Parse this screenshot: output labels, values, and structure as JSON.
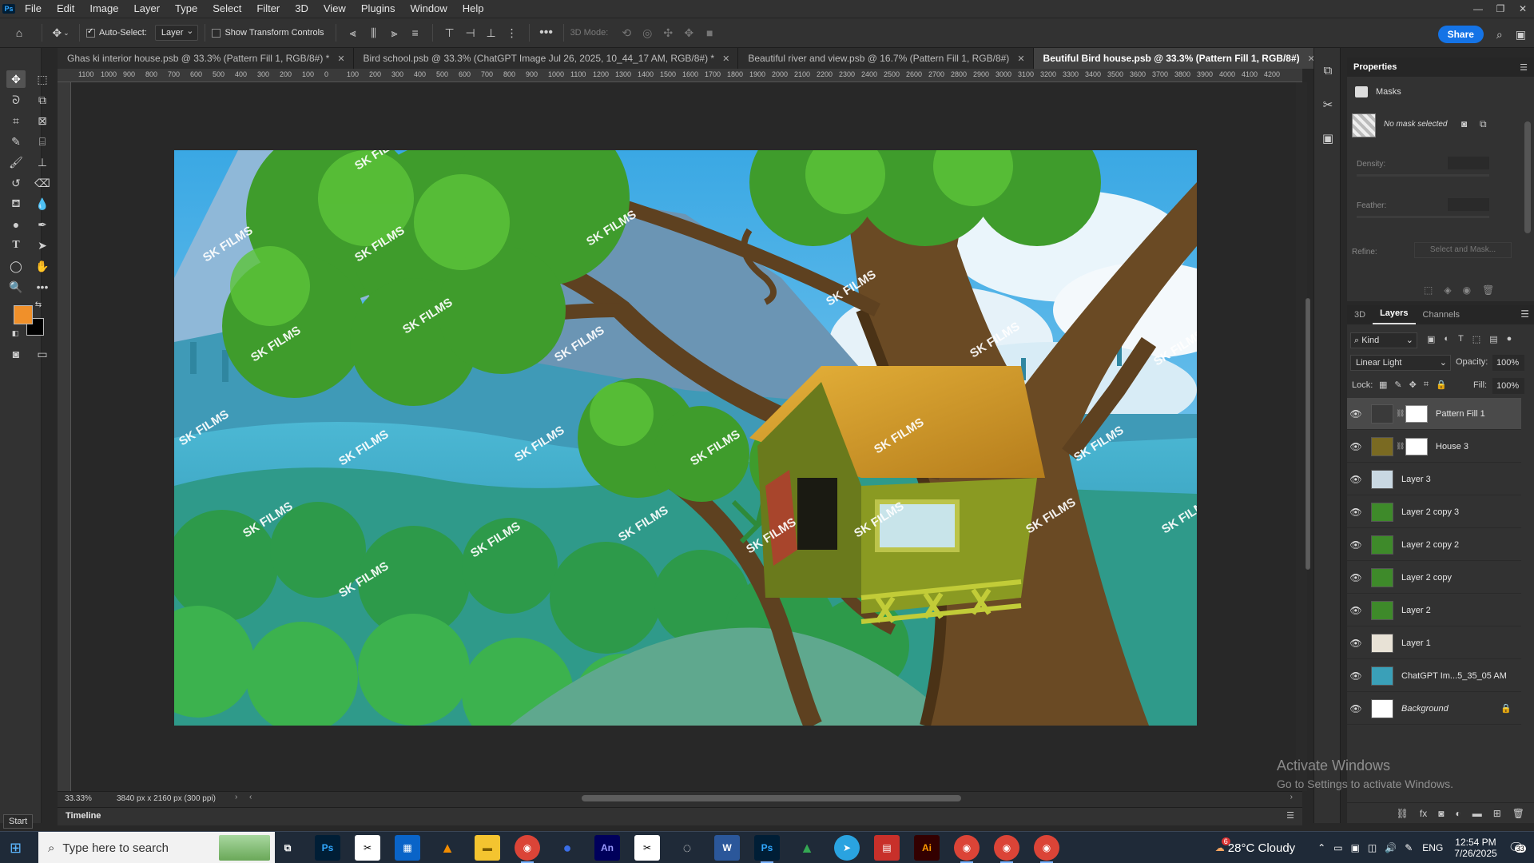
{
  "app": {
    "logo": "Ps"
  },
  "menu": [
    "File",
    "Edit",
    "Image",
    "Layer",
    "Type",
    "Select",
    "Filter",
    "3D",
    "View",
    "Plugins",
    "Window",
    "Help"
  ],
  "options_bar": {
    "auto_select_label": "Auto-Select:",
    "auto_select_checked": true,
    "auto_select_target": "Layer",
    "show_transform_label": "Show Transform Controls",
    "mode_3d_label": "3D Mode:",
    "share_label": "Share"
  },
  "tabs": [
    {
      "label": "Ghas ki interior house.psb @ 33.3% (Pattern Fill 1, RGB/8#) *",
      "active": false
    },
    {
      "label": "Bird school.psb @ 33.3% (ChatGPT Image Jul 26, 2025, 10_44_17 AM, RGB/8#) *",
      "active": false
    },
    {
      "label": "Beautiful river and view.psb @ 16.7% (Pattern Fill 1, RGB/8#)",
      "active": false
    },
    {
      "label": "Beutiful Bird house.psb @ 33.3% (Pattern Fill 1, RGB/8#)",
      "active": true
    }
  ],
  "ruler_labels": [
    "1100",
    "1000",
    "900",
    "800",
    "700",
    "600",
    "500",
    "400",
    "300",
    "200",
    "100",
    "0",
    "100",
    "200",
    "300",
    "400",
    "500",
    "600",
    "700",
    "800",
    "900",
    "1000",
    "1100",
    "1200",
    "1300",
    "1400",
    "1500",
    "1600",
    "1700",
    "1800",
    "1900",
    "2000",
    "2100",
    "2200",
    "2300",
    "2400",
    "2500",
    "2600",
    "2700",
    "2800",
    "2900",
    "3000",
    "3100",
    "3200",
    "3300",
    "3400",
    "3500",
    "3600",
    "3700",
    "3800",
    "3900",
    "4000",
    "4100",
    "4200"
  ],
  "canvas": {
    "watermark_text": "SK FILMS"
  },
  "status": {
    "zoom": "33.33%",
    "doc_info": "3840 px x 2160 px (300 ppi)"
  },
  "timeline_label": "Timeline",
  "properties": {
    "title": "Properties",
    "section": "Masks",
    "no_mask": "No mask selected",
    "density_label": "Density:",
    "feather_label": "Feather:",
    "refine_label": "Refine:",
    "select_mask_label": "Select and Mask..."
  },
  "layers_panel": {
    "tabs": [
      "3D",
      "Layers",
      "Channels"
    ],
    "active_tab": "Layers",
    "filter_kind": "Kind",
    "blend_mode": "Linear Light",
    "opacity_label": "Opacity:",
    "opacity_value": "100%",
    "lock_label": "Lock:",
    "fill_label": "Fill:",
    "fill_value": "100%",
    "layers": [
      {
        "name": "Pattern Fill 1",
        "selected": true,
        "has_mask": true,
        "thumb_color": "#3a3a3a"
      },
      {
        "name": "House 3",
        "selected": false,
        "has_mask": true,
        "thumb_color": "#7a6a22"
      },
      {
        "name": "Layer 3",
        "selected": false,
        "has_mask": false,
        "thumb_color": "#c9d8e2"
      },
      {
        "name": "Layer 2 copy 3",
        "selected": false,
        "has_mask": false,
        "thumb_color": "#3e8a2a"
      },
      {
        "name": "Layer 2 copy 2",
        "selected": false,
        "has_mask": false,
        "thumb_color": "#3e8a2a"
      },
      {
        "name": "Layer 2 copy",
        "selected": false,
        "has_mask": false,
        "thumb_color": "#3e8a2a"
      },
      {
        "name": "Layer 2",
        "selected": false,
        "has_mask": false,
        "thumb_color": "#3e8a2a"
      },
      {
        "name": "Layer 1",
        "selected": false,
        "has_mask": false,
        "thumb_color": "#e8e2d6"
      },
      {
        "name": "ChatGPT Im...5_35_05 AM",
        "selected": false,
        "has_mask": false,
        "thumb_color": "#3aa0b8"
      },
      {
        "name": "Background",
        "selected": false,
        "has_mask": false,
        "thumb_color": "#ffffff",
        "locked": true,
        "italic": true
      }
    ]
  },
  "activate_windows": {
    "line1": "Activate Windows",
    "line2": "Go to Settings to activate Windows."
  },
  "start_tooltip": "Start",
  "taskbar": {
    "search_placeholder": "Type here to search",
    "weather": "28°C  Cloudy",
    "weather_badge": "6",
    "language": "ENG",
    "time": "12:54 PM",
    "date": "7/26/2025",
    "notification_count": "33"
  },
  "colors": {
    "accent": "#1473e6",
    "foreground": "#f0902a",
    "background": "#000000"
  }
}
